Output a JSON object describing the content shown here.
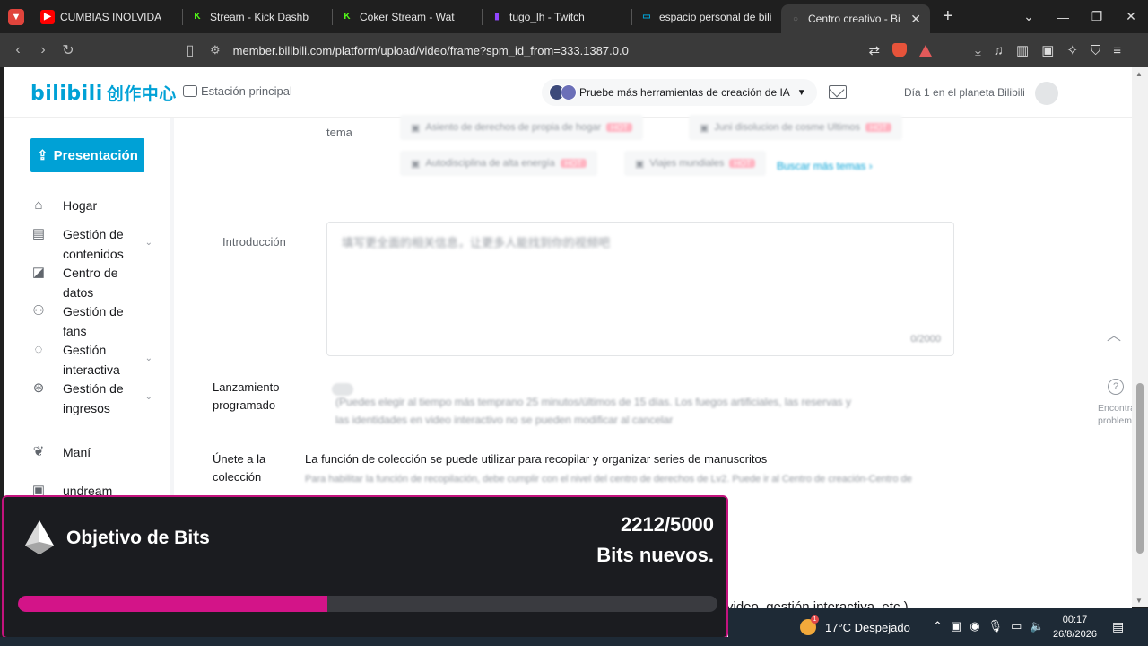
{
  "browser": {
    "tabs": [
      {
        "label": "CUMBIAS INOLVIDA",
        "favicon_color": "#ff0000",
        "favicon": "▶"
      },
      {
        "label": "Stream - Kick Dashb",
        "favicon_color": "#53fc18",
        "favicon": "K"
      },
      {
        "label": "Coker Stream - Wat",
        "favicon_color": "#53fc18",
        "favicon": "K"
      },
      {
        "label": "tugo_lh - Twitch",
        "favicon_color": "#9146ff",
        "favicon": "▮"
      },
      {
        "label": "espacio personal de bili",
        "favicon_color": "#00a1d6",
        "favicon": "▭"
      },
      {
        "label": "Centro creativo - Bi",
        "favicon_color": "#777777",
        "favicon": "○"
      }
    ],
    "new_tab": "+",
    "url": "member.bilibili.com/platform/upload/video/frame?spm_id_from=333.1387.0.0"
  },
  "header": {
    "logo": "bilibili",
    "logo_sub": "创作中心",
    "station": "Estación principal",
    "ai_tools": "Pruebe más herramientas de creación de IA",
    "planet": "Día 1 en el planeta Bilibili"
  },
  "sidebar": {
    "publish": "Presentación",
    "items": [
      {
        "label": "Hogar",
        "icon": "home-icon",
        "glyph": "⌂"
      },
      {
        "label": "Gestión de contenidos",
        "icon": "content-icon",
        "glyph": "▤"
      },
      {
        "label": "Centro de datos",
        "icon": "chart-icon",
        "glyph": "◪"
      },
      {
        "label": "Gestión de fans",
        "icon": "fans-icon",
        "glyph": "⚇"
      },
      {
        "label": "Gestión interactiva",
        "icon": "chat-icon",
        "glyph": "◌"
      },
      {
        "label": "Gestión de ingresos",
        "icon": "income-icon",
        "glyph": "⊛"
      },
      {
        "label": "Maní",
        "icon": "peanut-icon",
        "glyph": "❦"
      },
      {
        "label": "undream",
        "icon": "gift-icon",
        "glyph": "▣"
      }
    ]
  },
  "form": {
    "topic_label": "tema",
    "tags": [
      "Asiento de derechos de propia de hogar",
      "Juni disolucion de cosme Ultimos",
      "Autodisciplina de alta energía",
      "Viajes mundiales"
    ],
    "tag_badge": "HOT",
    "more_topics": "Buscar más temas ›",
    "intro_label": "Introducción",
    "intro_placeholder": "填写更全面的相关信息，让更多人能找到你的视频吧",
    "intro_count": "0/2000",
    "schedule_label": "Lanzamiento programado",
    "schedule_text_1": "(Puedes elegir al tiempo más temprano 25 minutos/últimos de 15 días. Los fuegos artificiales, las reservas y",
    "schedule_text_2": "las identidades en video interactivo no se pueden modificar al cancelar",
    "collection_label": "Únete a la colección",
    "collection_text": "La función de colección se puede utilizar para recopilar y organizar series de manuscritos",
    "collection_sub": "Para habilitar la función de recopilación, debe cumplir con el nivel del centro de derechos de Lv2. Puede ir al Centro de creación-Centro de",
    "bottom_text": "video, gestión interactiva, etc.)"
  },
  "help": {
    "icon": "?",
    "text": "Encontrar problemas"
  },
  "bits_goal": {
    "title": "Objetivo de Bits",
    "current": 2212,
    "target": 5000,
    "count_text": "2212/5000",
    "subtitle": "Bits nuevos.",
    "progress": 0.4424,
    "bar_color": "#d31488",
    "border_color": "#c4137e"
  },
  "taskbar": {
    "weather": "17°C Despejado",
    "weather_badge": "1",
    "time": "00:17",
    "date": "26/8/2026"
  }
}
